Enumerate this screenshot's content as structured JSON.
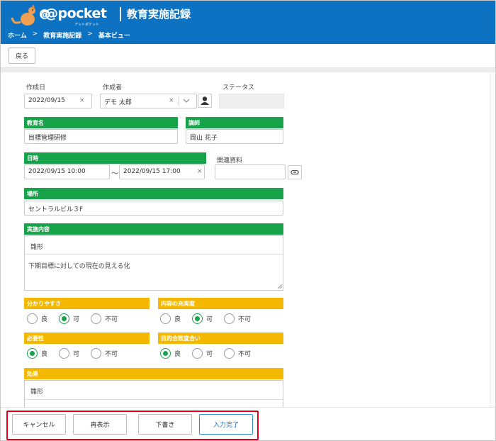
{
  "header": {
    "logo_text": "@pocket",
    "logo_sub": "アットポケット",
    "title": "教育実施記録",
    "breadcrumb": [
      "ホーム",
      "教育実施記録",
      "基本ビュー"
    ]
  },
  "toolbar": {
    "back_label": "戻る"
  },
  "form": {
    "created_date": {
      "label": "作成日",
      "value": "2022/09/15"
    },
    "author": {
      "label": "作成者",
      "value": "デモ 太郎"
    },
    "status": {
      "label": "ステータス",
      "value": ""
    },
    "course": {
      "label": "教育名",
      "value": "目標管理研修"
    },
    "instructor": {
      "label": "講師",
      "value": "岡山 花子"
    },
    "datetime": {
      "label": "日時",
      "start": "2022/09/15 10:00",
      "tilde": "～",
      "end": "2022/09/15 17:00"
    },
    "materials": {
      "label": "関連資料",
      "value": ""
    },
    "place": {
      "label": "場所",
      "value": "セントラルビル３F"
    },
    "content": {
      "label": "実施内容",
      "template_button": "雛形",
      "value": "下期目標に対しての現在の見える化"
    },
    "clarity": {
      "label": "分かりやすさ",
      "options": [
        "良",
        "可",
        "不可"
      ],
      "selected": "可"
    },
    "richness": {
      "label": "内容の充実度",
      "options": [
        "良",
        "可",
        "不可"
      ],
      "selected": "可"
    },
    "necessity": {
      "label": "必要性",
      "options": [
        "良",
        "可",
        "不可"
      ],
      "selected": "良"
    },
    "goal_fit": {
      "label": "目的合致度合い",
      "options": [
        "良",
        "可",
        "不可"
      ],
      "selected": "良"
    },
    "effect": {
      "label": "効果",
      "template_button": "雛形"
    }
  },
  "footer": {
    "cancel": "キャンセル",
    "redisplay": "再表示",
    "draft": "下書き",
    "complete": "入力完了"
  },
  "colors": {
    "header": "#0e72c2",
    "green": "#16a34a",
    "yellow": "#f5b800",
    "highlight": "#e2001a"
  }
}
